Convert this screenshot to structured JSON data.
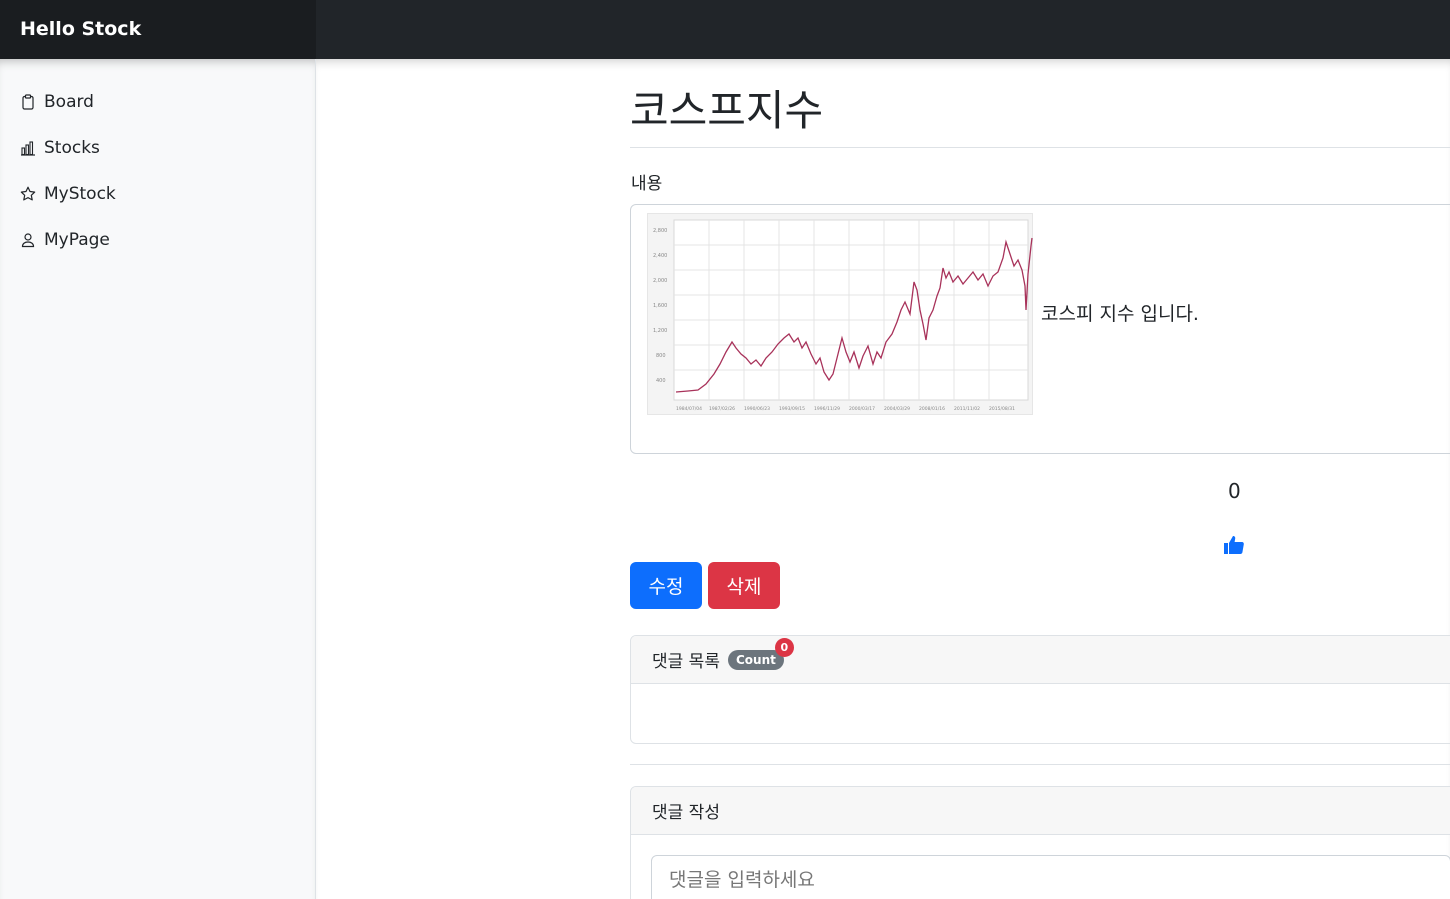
{
  "brand": "Hello Stock",
  "sidebar": {
    "items": [
      {
        "label": "Board",
        "icon": "clipboard-icon"
      },
      {
        "label": "Stocks",
        "icon": "bar-chart-icon"
      },
      {
        "label": "MyStock",
        "icon": "star-icon"
      },
      {
        "label": "MyPage",
        "icon": "person-icon"
      }
    ]
  },
  "post": {
    "title": "코스프지수",
    "content_label": "내용",
    "content_text": "코스피 지수 입니다.",
    "like_count": "0"
  },
  "buttons": {
    "edit": "수정",
    "delete": "삭제"
  },
  "comments": {
    "list_title": "댓글 목록",
    "count_label": "Count",
    "count_value": "0",
    "write_title": "댓글 작성",
    "input_placeholder": "댓글을 입력하세요"
  },
  "colors": {
    "primary": "#0d6efd",
    "danger": "#dc3545",
    "navbar": "#212529",
    "chart_line": "#a8325a"
  }
}
